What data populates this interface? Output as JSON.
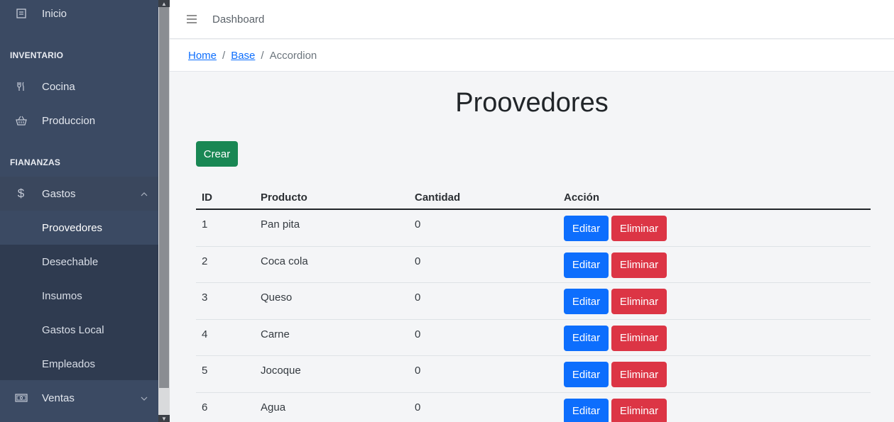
{
  "sidebar": {
    "inicio": "Inicio",
    "section_inventario": "INVENTARIO",
    "cocina": "Cocina",
    "produccion": "Produccion",
    "section_finanzas": "FIANANZAS",
    "gastos": "Gastos",
    "sub_items": [
      "Proovedores",
      "Desechable",
      "Insumos",
      "Gastos Local",
      "Empleados"
    ],
    "ventas": "Ventas"
  },
  "header": {
    "title": "Dashboard"
  },
  "breadcrumb": {
    "home": "Home",
    "base": "Base",
    "current": "Accordion",
    "separator": "/"
  },
  "main": {
    "title": "Proovedores",
    "create_label": "Crear",
    "edit_label": "Editar",
    "delete_label": "Eliminar"
  },
  "table": {
    "headers": [
      "ID",
      "Producto",
      "Cantidad",
      "Acción"
    ],
    "rows": [
      {
        "id": "1",
        "producto": "Pan pita",
        "cantidad": "0"
      },
      {
        "id": "2",
        "producto": "Coca cola",
        "cantidad": "0"
      },
      {
        "id": "3",
        "producto": "Queso",
        "cantidad": "0"
      },
      {
        "id": "4",
        "producto": "Carne",
        "cantidad": "0"
      },
      {
        "id": "5",
        "producto": "Jocoque",
        "cantidad": "0"
      },
      {
        "id": "6",
        "producto": "Agua",
        "cantidad": "0"
      }
    ]
  },
  "icons": {
    "inicio": "document-icon",
    "cocina": "utensils-icon",
    "produccion": "basket-icon",
    "gastos": "dollar-icon",
    "ventas": "cash-icon"
  },
  "colors": {
    "sidebar_bg": "#3b4a63",
    "create": "#198754",
    "edit": "#0d6efd",
    "delete": "#dc3545"
  }
}
